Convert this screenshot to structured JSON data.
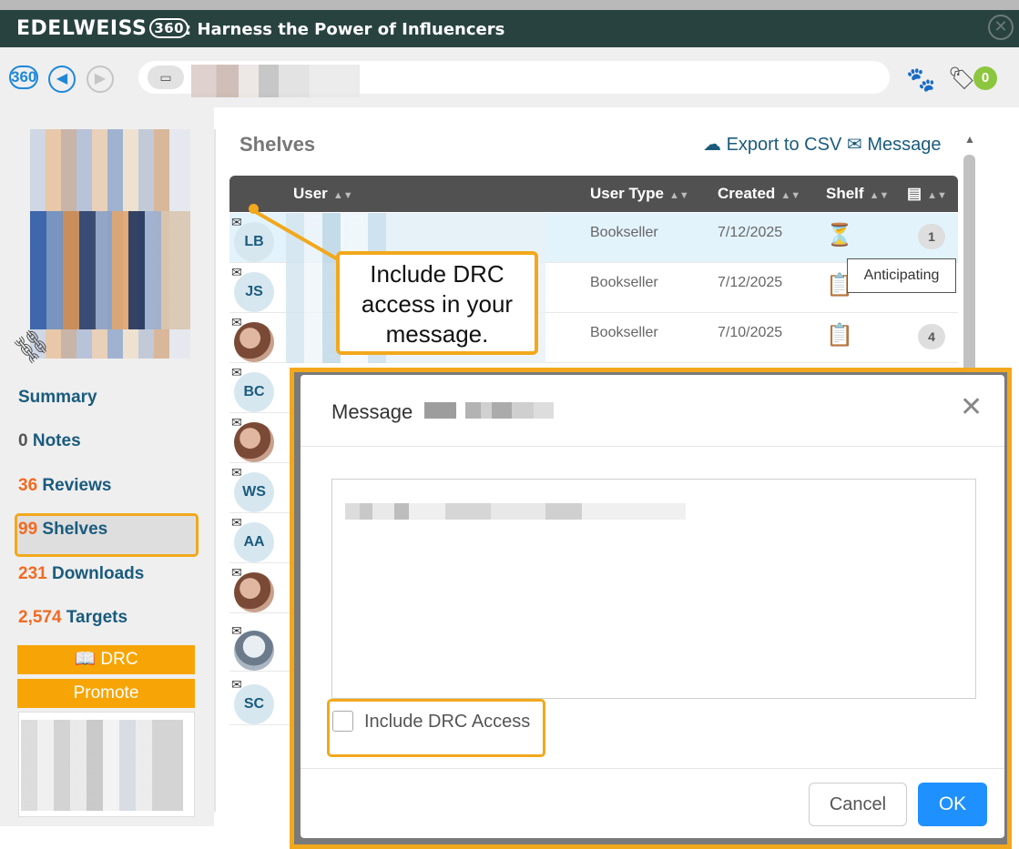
{
  "app": {
    "brand": "EDELWEISS",
    "brand_badge": "360",
    "title": ": Harness the Power of Influencers"
  },
  "nav": {
    "badge_360": "360",
    "tag_count": "0"
  },
  "sidebar": {
    "items": [
      {
        "count": "",
        "label": "Summary"
      },
      {
        "count": "0",
        "label": "Notes"
      },
      {
        "count": "36",
        "label": "Reviews"
      },
      {
        "count": "99",
        "label": "Shelves"
      },
      {
        "count": "231",
        "label": "Downloads"
      },
      {
        "count": "2,574",
        "label": "Targets"
      }
    ],
    "drc_label": "DRC",
    "promote_label": "Promote"
  },
  "shelves": {
    "title": "Shelves",
    "export_label": "Export to CSV",
    "message_label": "Message",
    "columns": [
      "User",
      "User Type",
      "Created",
      "Shelf"
    ],
    "rows": [
      {
        "initials": "LB",
        "user_type": "Bookseller",
        "created": "7/12/2025",
        "shelf_icon": "hourglass-icon",
        "count": "1"
      },
      {
        "initials": "JS",
        "user_type": "Bookseller",
        "created": "7/12/2025",
        "shelf_icon": "clipboard-check-icon",
        "count": ""
      },
      {
        "initials": "",
        "user_type": "Bookseller",
        "created": "7/10/2025",
        "shelf_icon": "clipboard-check-icon",
        "count": "4"
      },
      {
        "initials": "BC"
      },
      {
        "initials": ""
      },
      {
        "initials": "WS"
      },
      {
        "initials": "AA"
      },
      {
        "initials": ""
      },
      {
        "initials": ""
      },
      {
        "initials": "SC"
      }
    ],
    "tooltip": "Anticipating"
  },
  "callout": {
    "text": "Include DRC access in your message."
  },
  "modal": {
    "title": "Message",
    "checkbox_label": "Include DRC Access",
    "cancel_label": "Cancel",
    "ok_label": "OK"
  },
  "colors": {
    "titlebar": "#28423f",
    "accent_orange": "#f7a506",
    "highlight": "#f2a81c",
    "link_blue": "#1a5b7d",
    "ok_blue": "#1e90ff"
  }
}
